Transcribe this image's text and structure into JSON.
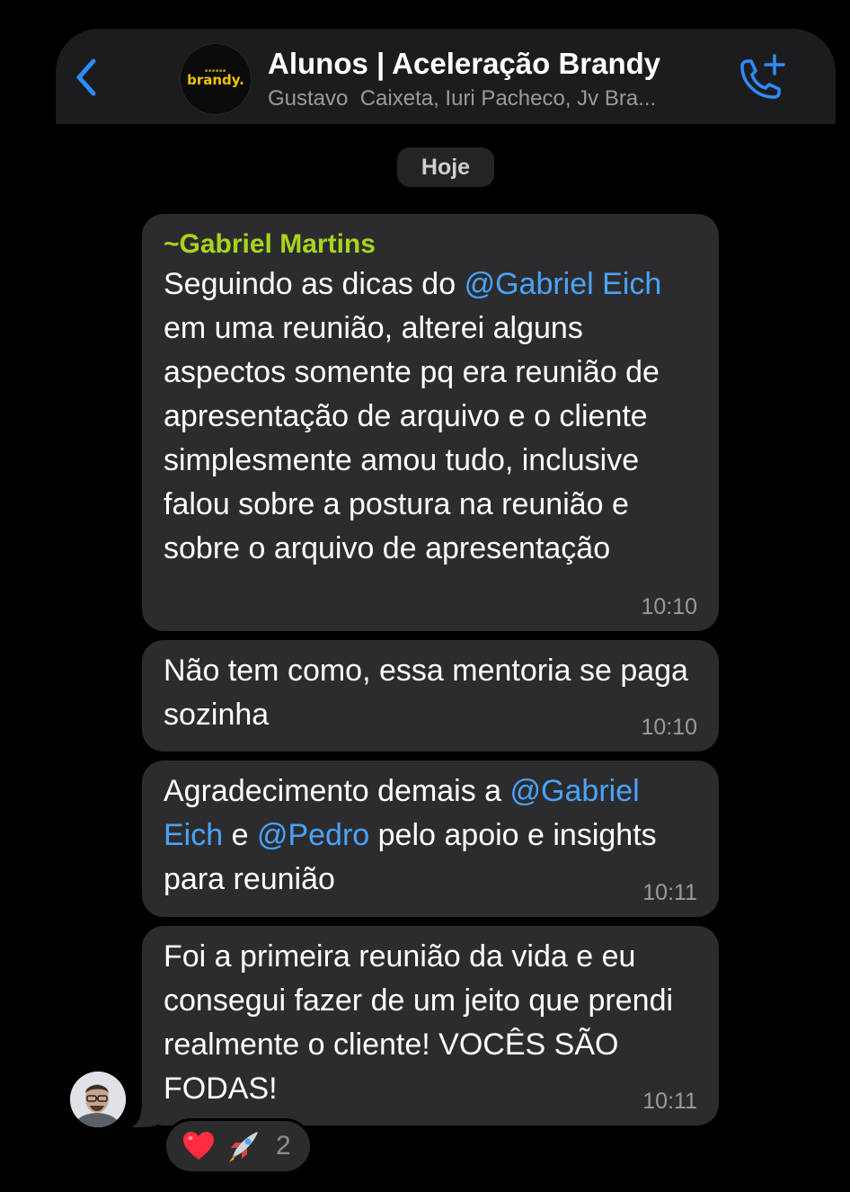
{
  "header": {
    "title": "Alunos | Aceleração Brandy",
    "subtitle": "Gustavo  Caixeta, Iuri Pacheco, Jv Bra...",
    "group_logo_text": "brandy.",
    "icons": {
      "back": "chevron-left-icon",
      "call": "phone-plus-icon"
    },
    "accent_color": "#2f8cff"
  },
  "date_separator": "Hoje",
  "messages": [
    {
      "sender": "~Gabriel Martins",
      "parts": [
        "Seguindo as dicas do ",
        "@Gabriel Eich",
        " em uma reunião, alterei alguns aspectos somente pq era reunião de apresentação de arquivo e o cliente simplesmente amou tudo, inclusive falou sobre a postura na reunião e sobre o arquivo de apresentação"
      ],
      "time": "10:10"
    },
    {
      "text": "Não tem como, essa mentoria se paga sozinha",
      "time": "10:10"
    },
    {
      "parts": [
        "Agradecimento demais a ",
        "@Gabriel Eich",
        " e ",
        "@Pedro",
        " pelo apoio e insights para reunião"
      ],
      "time": "10:11"
    },
    {
      "text": "Foi a primeira reunião da vida e eu consegui fazer de um jeito que prendi realmente o cliente! VOCÊS SÃO FODAS!",
      "time": "10:11"
    }
  ],
  "reactions": {
    "items": [
      "heart-icon",
      "rocket-icon"
    ],
    "count": "2"
  },
  "colors": {
    "background": "#000000",
    "bubble": "#2c2c2e",
    "mention": "#4aa3ff",
    "sender_name": "#a8d51c",
    "timestamp": "#9a9a9f"
  }
}
